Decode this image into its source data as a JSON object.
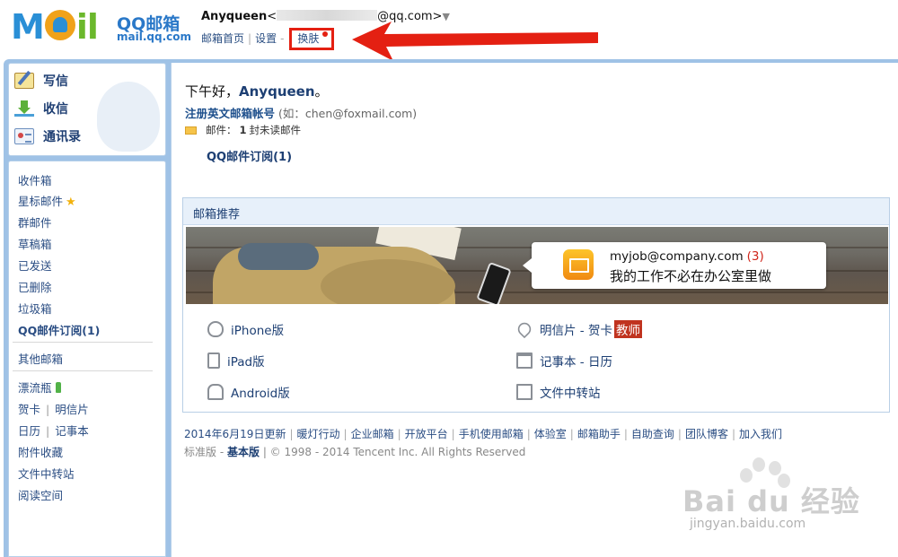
{
  "header": {
    "logo_text_left": "M",
    "logo_text_right": "il",
    "logo_name": "QQ邮箱",
    "logo_domain": "mail.qq.com",
    "user_name": "Anyqueen",
    "user_email_prefix": "<",
    "user_email_suffix": "@qq.com>",
    "links": [
      "邮箱首页",
      "设置",
      "换肤"
    ]
  },
  "sidebar": {
    "actions": [
      {
        "label": "写信",
        "icon": "compose-icon"
      },
      {
        "label": "收信",
        "icon": "inbox-download-icon"
      },
      {
        "label": "通讯录",
        "icon": "contacts-icon"
      }
    ],
    "folders": {
      "inbox": "收件箱",
      "starred": "星标邮件",
      "group": "群邮件",
      "drafts": "草稿箱",
      "sent": "已发送",
      "deleted": "已删除",
      "spam": "垃圾箱",
      "subscription": "QQ邮件订阅(1)",
      "other": "其他邮箱",
      "bottle": "漂流瓶",
      "cards": "贺卡",
      "postcards": "明信片",
      "calendar": "日历",
      "notes": "记事本",
      "attachments": "附件收藏",
      "transfer": "文件中转站",
      "reading": "阅读空间"
    }
  },
  "main": {
    "greeting_prefix": "下午好，",
    "greeting_name": "Anyqueen",
    "greeting_suffix": "。",
    "register_link": "注册英文邮箱帐号",
    "register_hint": "(如：chen@foxmail.com)",
    "mail_label": "邮件：",
    "unread_count": "1",
    "unread_suffix": "封未读邮件",
    "subscription_link": "QQ邮件订阅(1)",
    "recommend_title": "邮箱推荐",
    "banner_email": "myjob@company.com",
    "banner_count": "(3)",
    "banner_slogan": "我的工作不必在办公室里做",
    "versions": {
      "iphone": "iPhone版",
      "ipad": "iPad版",
      "android": "Android版",
      "postcard": "明信片 - 贺卡",
      "teacher_tag": "教师",
      "notebook": "记事本 - 日历",
      "transfer": "文件中转站"
    }
  },
  "footer": {
    "links": [
      "2014年6月19日更新",
      "暖灯行动",
      "企业邮箱",
      "开放平台",
      "手机使用邮箱",
      "体验室",
      "邮箱助手",
      "自助查询",
      "团队博客",
      "加入我们"
    ],
    "std_label": "标准版",
    "dash": " - ",
    "basic_label": "基本版",
    "copyright": "| © 1998 - 2014 Tencent Inc. All Rights Reserved"
  },
  "watermark": {
    "text": "Bai du 经验",
    "url": "jingyan.baidu.com"
  },
  "colors": {
    "frame_blue": "#9fc2e6",
    "link_blue": "#1d3f73",
    "highlight_red": "#e42012"
  }
}
